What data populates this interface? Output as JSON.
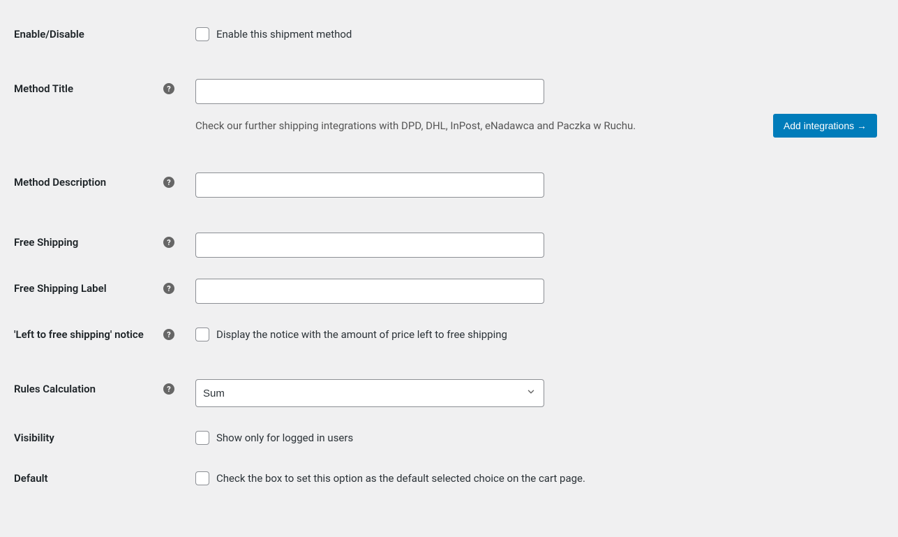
{
  "fields": {
    "enableDisable": {
      "label": "Enable/Disable",
      "checkboxLabel": "Enable this shipment method"
    },
    "methodTitle": {
      "label": "Method Title",
      "value": "",
      "helperText": "Check our further shipping integrations with DPD, DHL, InPost, eNadawca and Paczka w Ruchu.",
      "buttonLabel": "Add integrations →"
    },
    "methodDescription": {
      "label": "Method Description",
      "value": ""
    },
    "freeShipping": {
      "label": "Free Shipping",
      "value": ""
    },
    "freeShippingLabel": {
      "label": "Free Shipping Label",
      "value": ""
    },
    "leftToFreeShipping": {
      "label": "'Left to free shipping' notice",
      "checkboxLabel": "Display the notice with the amount of price left to free shipping"
    },
    "rulesCalculation": {
      "label": "Rules Calculation",
      "selected": "Sum"
    },
    "visibility": {
      "label": "Visibility",
      "checkboxLabel": "Show only for logged in users"
    },
    "default": {
      "label": "Default",
      "checkboxLabel": "Check the box to set this option as the default selected choice on the cart page."
    }
  }
}
